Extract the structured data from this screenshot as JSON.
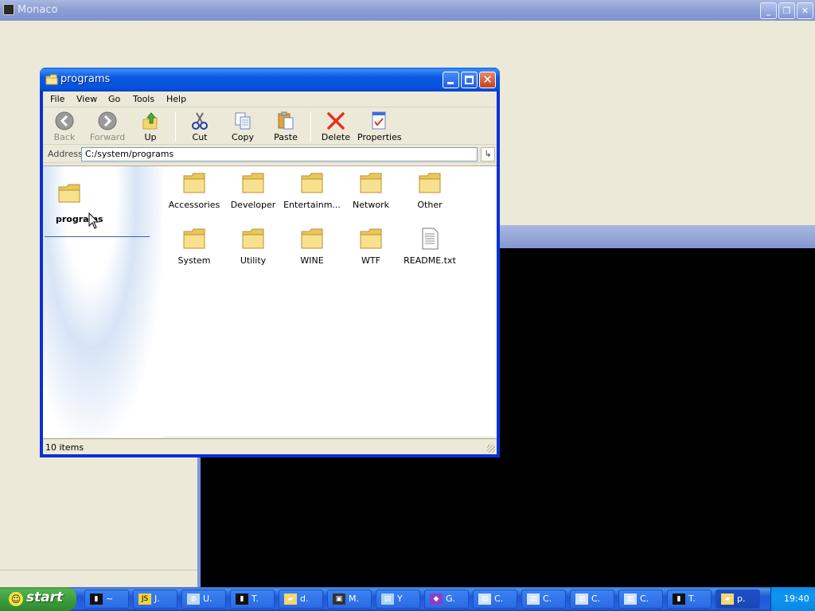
{
  "bg_window": {
    "title": "Monaco"
  },
  "explorer": {
    "title": "programs",
    "menu": [
      "File",
      "View",
      "Go",
      "Tools",
      "Help"
    ],
    "toolbar": {
      "back": "Back",
      "forward": "Forward",
      "up": "Up",
      "cut": "Cut",
      "copy": "Copy",
      "paste": "Paste",
      "delete": "Delete",
      "properties": "Properties"
    },
    "address_label": "Address",
    "address_value": "C:/system/programs",
    "task_pane_label": "programs",
    "items": [
      {
        "name": "Accessories",
        "type": "folder"
      },
      {
        "name": "Developer",
        "type": "folder"
      },
      {
        "name": "Entertainm...",
        "type": "folder"
      },
      {
        "name": "Network",
        "type": "folder"
      },
      {
        "name": "Other",
        "type": "folder"
      },
      {
        "name": "System",
        "type": "folder"
      },
      {
        "name": "Utility",
        "type": "folder"
      },
      {
        "name": "WINE",
        "type": "folder"
      },
      {
        "name": "WTF",
        "type": "folder"
      },
      {
        "name": "README.txt",
        "type": "text-file"
      }
    ],
    "status": "10 items"
  },
  "taskbar": {
    "start": "start",
    "buttons": [
      {
        "label": "~",
        "icon": "terminal-icon"
      },
      {
        "label": "J.",
        "icon": "javascript-icon"
      },
      {
        "label": "U.",
        "icon": "globe-icon"
      },
      {
        "label": "T.",
        "icon": "terminal-icon"
      },
      {
        "label": "d.",
        "icon": "folder-icon"
      },
      {
        "label": "M.",
        "icon": "monaco-icon"
      },
      {
        "label": "Y",
        "icon": "document-icon"
      },
      {
        "label": "G.",
        "icon": "cube-icon"
      },
      {
        "label": "C.",
        "icon": "computer-icon"
      },
      {
        "label": "C.",
        "icon": "computer-icon"
      },
      {
        "label": "C.",
        "icon": "computer-icon"
      },
      {
        "label": "C.",
        "icon": "computer-icon"
      },
      {
        "label": "T.",
        "icon": "terminal-icon"
      },
      {
        "label": "p.",
        "icon": "folder-icon"
      }
    ],
    "clock": "19:40"
  }
}
